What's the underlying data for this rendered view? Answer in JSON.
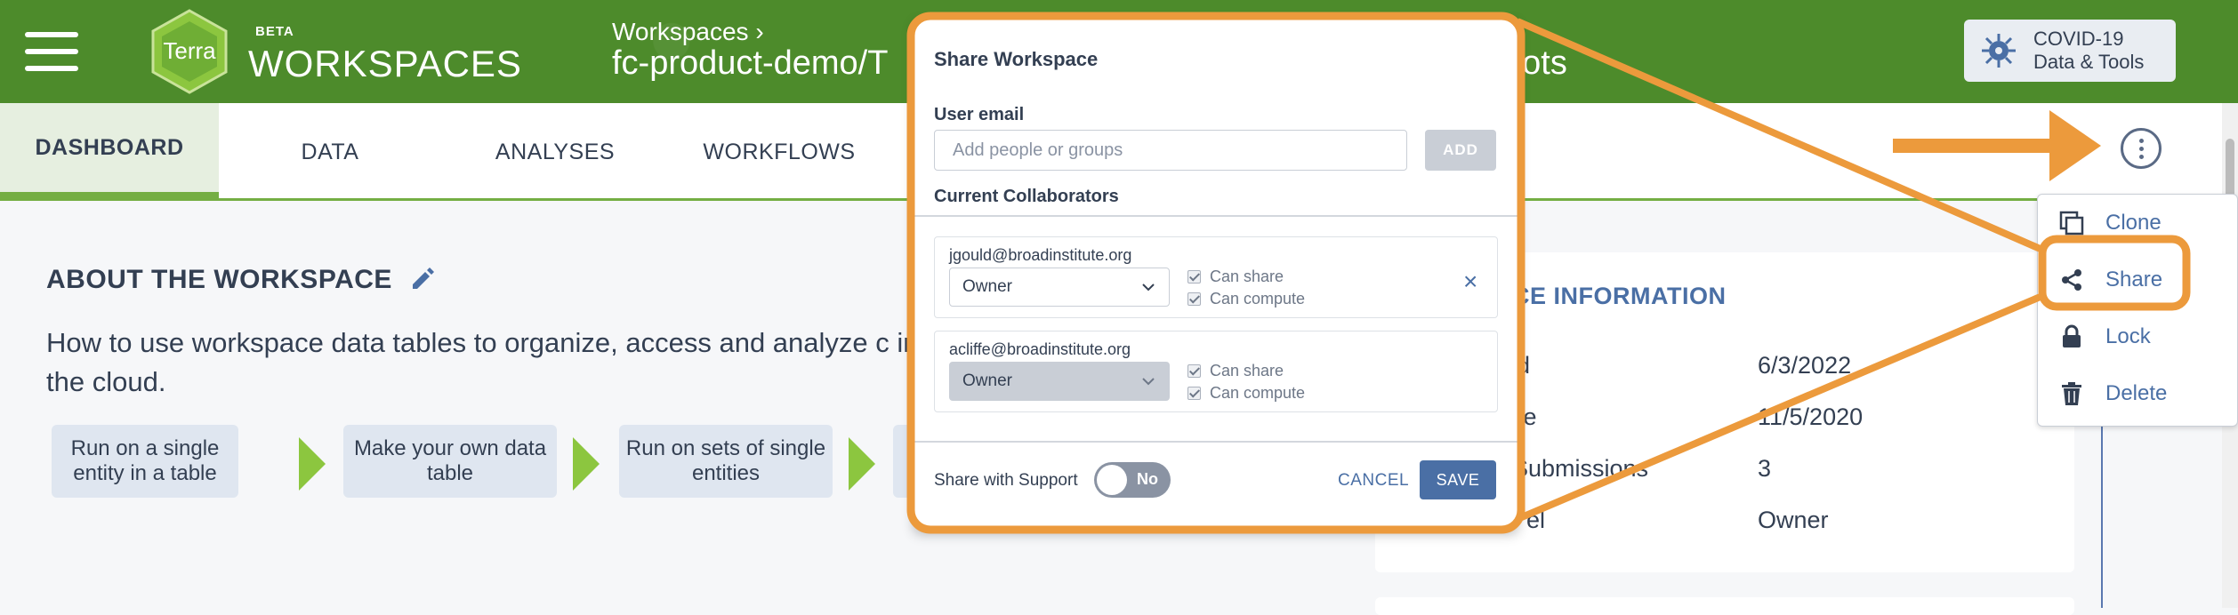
{
  "header": {
    "logo_text": "Terra",
    "beta": "BETA",
    "brand": "WORKSPACES",
    "breadcrumb": "Workspaces ›",
    "workspace_name": "fc-product-demo/T",
    "workspace_name_tail": "hots",
    "covid_line1": "COVID-19",
    "covid_line2": "Data & Tools"
  },
  "tabs": [
    {
      "label": "DASHBOARD",
      "active": true
    },
    {
      "label": "DATA"
    },
    {
      "label": "ANALYSES"
    },
    {
      "label": "WORKFLOWS"
    }
  ],
  "about": {
    "title": "ABOUT THE WORKSPACE",
    "description": "How to use workspace data tables to organize, access and analyze c in the cloud.",
    "steps": [
      "Run on a single entity in a table",
      "Make your own data table",
      "Run on sets of single entities"
    ]
  },
  "info": {
    "title": "CE INFORMATION",
    "rows": [
      {
        "label": "ed",
        "value": "6/3/2022"
      },
      {
        "label": "ate",
        "value": "11/5/2020"
      },
      {
        "label": "Submissions",
        "value": "3"
      },
      {
        "label": "el",
        "value": "Owner"
      }
    ]
  },
  "menu": {
    "items": [
      {
        "label": "Clone",
        "icon": "clone-icon"
      },
      {
        "label": "Share",
        "icon": "share-icon"
      },
      {
        "label": "Lock",
        "icon": "lock-icon"
      },
      {
        "label": "Delete",
        "icon": "trash-icon"
      }
    ]
  },
  "share_modal": {
    "title": "Share Workspace",
    "user_email_label": "User email",
    "email_placeholder": "Add people or groups",
    "add_label": "ADD",
    "collaborators_label": "Current Collaborators",
    "collaborators": [
      {
        "email": "jgould@broadinstitute.org",
        "role": "Owner",
        "can_share": "Can share",
        "can_compute": "Can compute",
        "removable": true
      },
      {
        "email": "acliffe@broadinstitute.org",
        "role": "Owner",
        "can_share": "Can share",
        "can_compute": "Can compute",
        "removable": false
      }
    ],
    "support_label": "Share with Support",
    "support_toggle": "No",
    "cancel_label": "CANCEL",
    "save_label": "SAVE"
  },
  "colors": {
    "header_green": "#4d8b2b",
    "accent_green": "#74ae43",
    "link_blue": "#4a6fa5",
    "annotation_orange": "#ec9a3c"
  }
}
